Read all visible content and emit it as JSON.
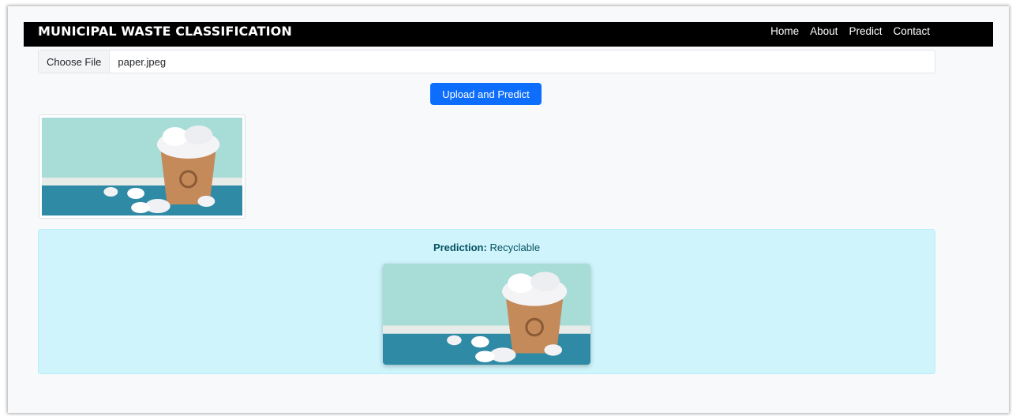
{
  "navbar": {
    "brand": "MUNICIPAL WASTE CLASSIFICATION",
    "links": [
      "Home",
      "About",
      "Predict",
      "Contact"
    ]
  },
  "upload": {
    "choose_label": "Choose File",
    "file_name": "paper.jpeg",
    "button_label": "Upload and Predict"
  },
  "result": {
    "prediction_label": "Prediction:",
    "prediction_value": "Recyclable"
  },
  "colors": {
    "navbar_bg": "#000000",
    "primary_button": "#0d6efd",
    "alert_bg": "#cff4fc",
    "alert_text": "#055160"
  }
}
